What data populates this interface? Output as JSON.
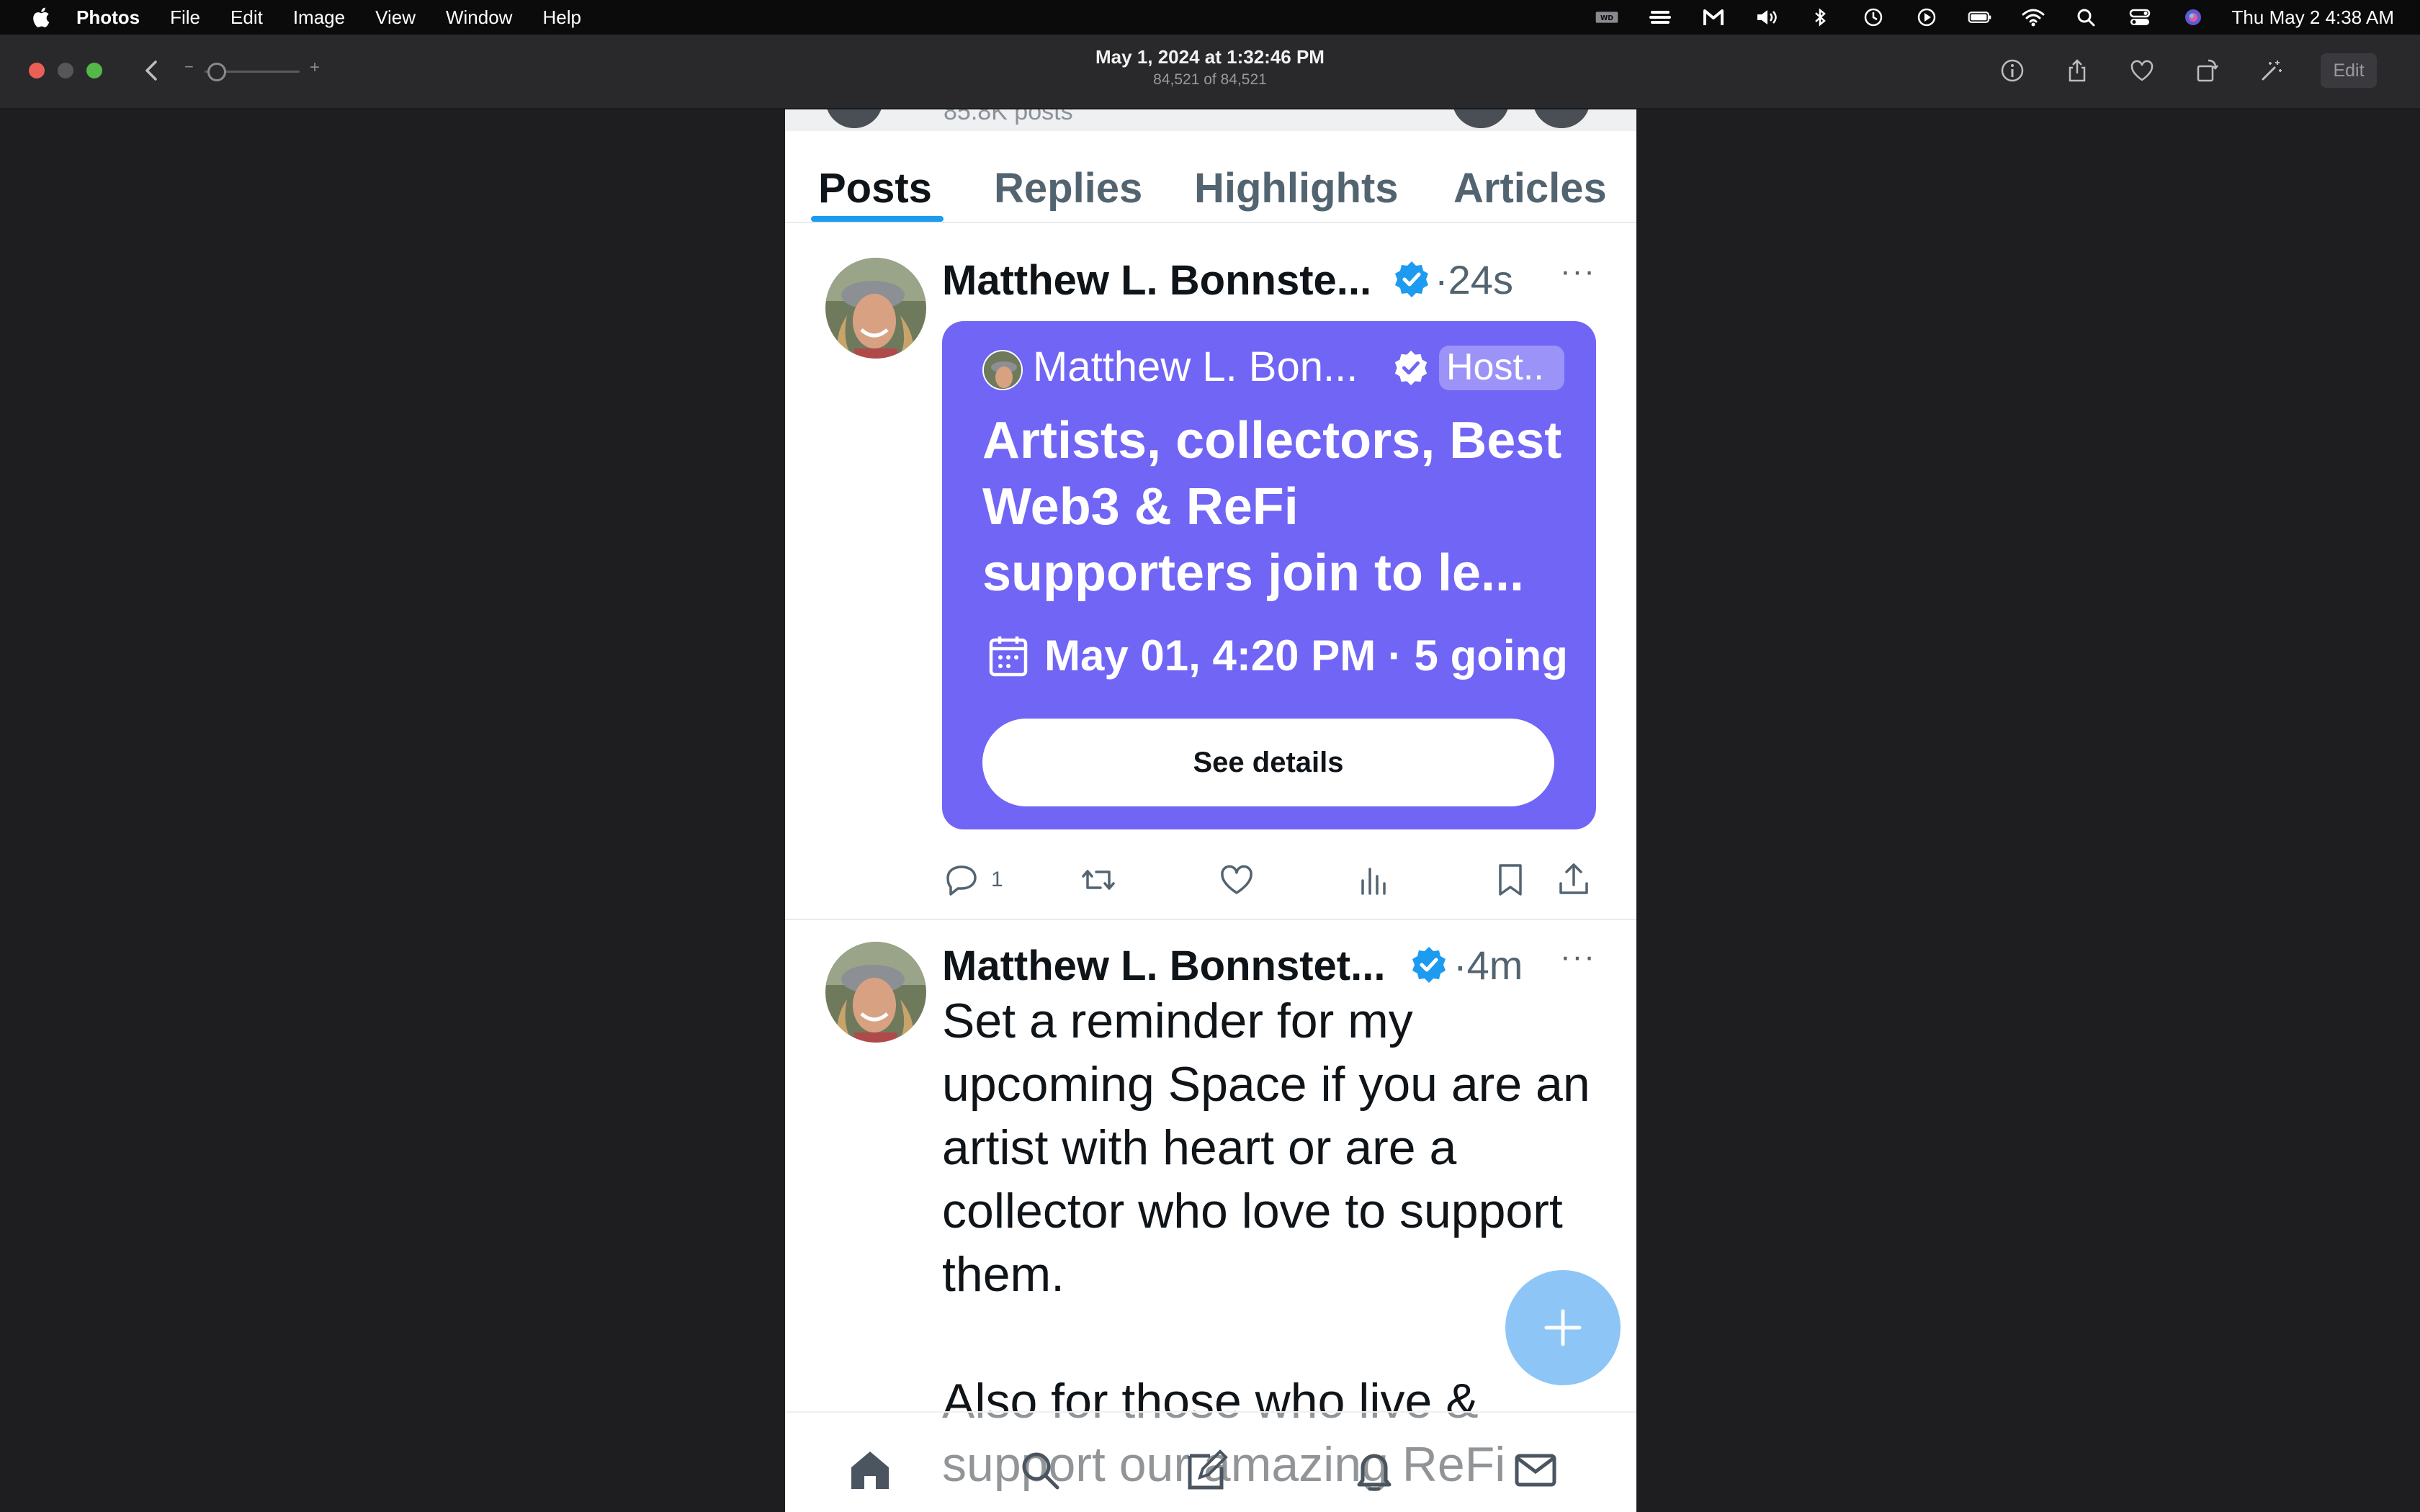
{
  "menubar": {
    "app_name": "Photos",
    "menus": [
      "File",
      "Edit",
      "Image",
      "View",
      "Window",
      "Help"
    ],
    "clock": "Thu May 2  4:38 AM"
  },
  "window": {
    "title": "May 1, 2024 at 1:32:46 PM",
    "subtitle": "84,521 of 84,521",
    "edit_label": "Edit"
  },
  "phone": {
    "header_remnant": "85.8K posts",
    "tabs": [
      {
        "label": "Posts",
        "active": true
      },
      {
        "label": "Replies",
        "active": false
      },
      {
        "label": "Highlights",
        "active": false
      },
      {
        "label": "Articles",
        "active": false
      }
    ],
    "post1": {
      "author": "Matthew L. Bonnste...",
      "time": "24s",
      "space": {
        "host_name": "Matthew L. Bon...",
        "host_badge": "Host..",
        "title": "Artists, collectors, Best Web3 & ReFi supporters join to le...",
        "date_line": "May 01, 4:20 PM · 5 going",
        "button": "See details"
      },
      "reply_count": "1"
    },
    "post2": {
      "author": "Matthew L. Bonnstet...",
      "time": "4m",
      "text": "Set a reminder for my upcoming Space if you are an artist with heart or are a collector who love to support them.\n\nAlso for those who live & support our amazing ReFi"
    }
  },
  "colors": {
    "accent": "#1d9bf0",
    "space_card": "#7165f6",
    "fab": "#8dc6f6"
  },
  "icons": {
    "toolbar": [
      "info-icon",
      "share-icon",
      "heart-icon",
      "rotate-icon",
      "enhance-icon"
    ],
    "actions": [
      "reply-icon",
      "repost-icon",
      "like-icon",
      "views-icon",
      "bookmark-icon",
      "share-icon"
    ],
    "nav": [
      "home-icon",
      "search-icon",
      "compose-icon",
      "notifications-icon",
      "messages-icon"
    ]
  }
}
